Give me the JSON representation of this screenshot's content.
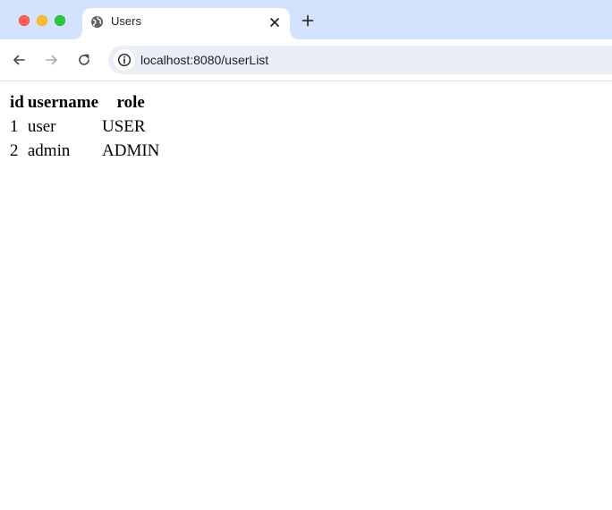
{
  "browser": {
    "tab": {
      "title": "Users",
      "favicon": "globe-icon"
    },
    "toolbar": {
      "url": "localhost:8080/userList",
      "back_icon": "arrow-left-icon",
      "forward_icon": "arrow-right-icon",
      "reload_icon": "reload-icon",
      "site_info_icon": "info-icon"
    },
    "colors": {
      "tabstrip": "#d3e3fd",
      "omnibox": "#e9eef6",
      "close": "#ff5f57",
      "minimize": "#febc2e",
      "maximize": "#28c840"
    }
  },
  "page": {
    "table": {
      "headers": [
        "id",
        "username",
        "role"
      ],
      "rows": [
        [
          "1",
          "user",
          "USER"
        ],
        [
          "2",
          "admin",
          "ADMIN"
        ]
      ]
    }
  }
}
